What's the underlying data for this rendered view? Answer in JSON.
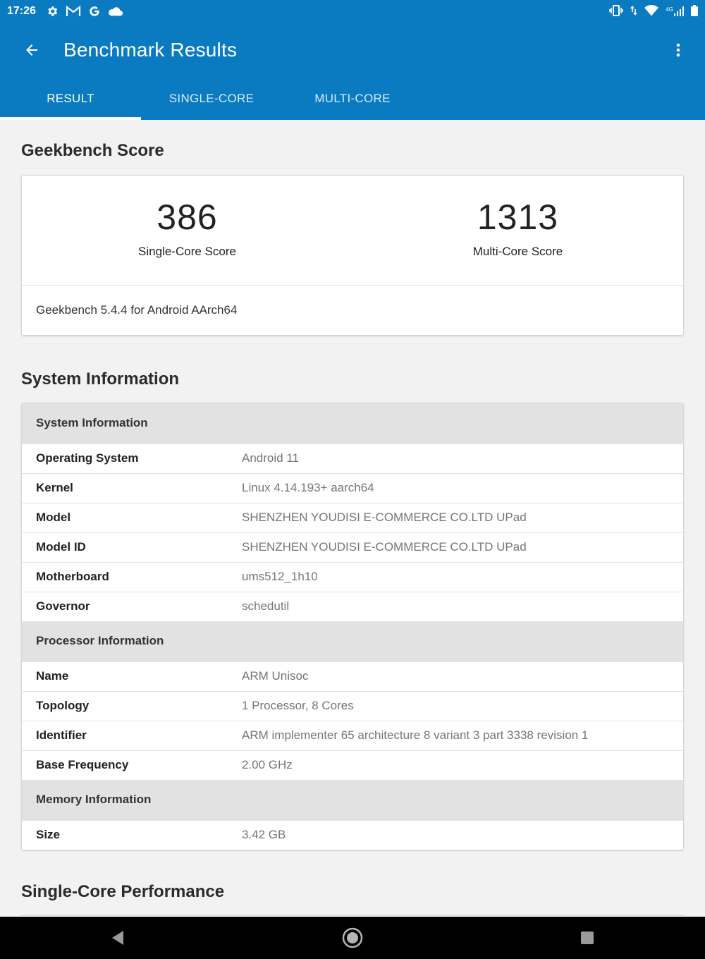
{
  "status_bar": {
    "time": "17:26",
    "left_icons": [
      "gear-icon",
      "gmail-icon",
      "google-icon",
      "cloud-icon"
    ],
    "right_icons": [
      "vibrate-icon",
      "data-arrows-icon",
      "wifi-icon",
      "signal-icon",
      "battery-icon"
    ],
    "network_label": "4G"
  },
  "app_bar": {
    "title": "Benchmark Results"
  },
  "tabs": [
    {
      "label": "RESULT",
      "active": true
    },
    {
      "label": "SINGLE-CORE",
      "active": false
    },
    {
      "label": "MULTI-CORE",
      "active": false
    }
  ],
  "geekbench": {
    "section_title": "Geekbench Score",
    "single_core": {
      "value": "386",
      "label": "Single-Core Score"
    },
    "multi_core": {
      "value": "1313",
      "label": "Multi-Core Score"
    },
    "version": "Geekbench 5.4.4 for Android AArch64"
  },
  "system_info": {
    "section_title": "System Information",
    "groups": [
      {
        "title": "System Information",
        "rows": [
          {
            "key": "Operating System",
            "value": "Android 11"
          },
          {
            "key": "Kernel",
            "value": "Linux 4.14.193+ aarch64"
          },
          {
            "key": "Model",
            "value": "SHENZHEN YOUDISI E-COMMERCE CO.LTD UPad"
          },
          {
            "key": "Model ID",
            "value": "SHENZHEN YOUDISI E-COMMERCE CO.LTD UPad"
          },
          {
            "key": "Motherboard",
            "value": "ums512_1h10"
          },
          {
            "key": "Governor",
            "value": "schedutil"
          }
        ]
      },
      {
        "title": "Processor Information",
        "rows": [
          {
            "key": "Name",
            "value": "ARM Unisoc"
          },
          {
            "key": "Topology",
            "value": "1 Processor, 8 Cores"
          },
          {
            "key": "Identifier",
            "value": "ARM implementer 65 architecture 8 variant 3 part 3338 revision 1"
          },
          {
            "key": "Base Frequency",
            "value": "2.00 GHz"
          }
        ]
      },
      {
        "title": "Memory Information",
        "rows": [
          {
            "key": "Size",
            "value": "3.42 GB"
          }
        ]
      }
    ]
  },
  "single_core_performance": {
    "section_title": "Single-Core Performance"
  },
  "colors": {
    "app_bar": "#0a7bc1",
    "group_header": "#e2e2e2",
    "background": "#f2f2f2"
  }
}
